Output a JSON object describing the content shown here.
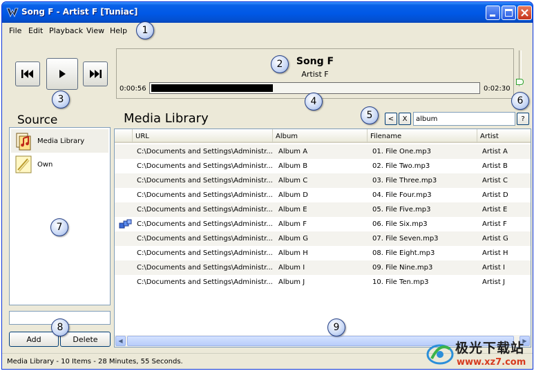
{
  "window": {
    "title": "Song F - Artist F [Tuniac]"
  },
  "menu": [
    "File",
    "Edit",
    "Playback",
    "View",
    "Help"
  ],
  "player": {
    "song_title": "Song F",
    "song_artist": "Artist F",
    "elapsed": "0:00:56",
    "total": "0:02:30",
    "progress": 0.37,
    "volume": 0.15
  },
  "source": {
    "label": "Source",
    "items": [
      {
        "label": "Media Library",
        "icon": "media-library-icon",
        "selected": true
      },
      {
        "label": "Own",
        "icon": "playlist-icon",
        "selected": false
      }
    ],
    "add_label": "Add",
    "delete_label": "Delete"
  },
  "library": {
    "title": "Media Library",
    "back_label": "<",
    "clear_label": "X",
    "search_value": "album",
    "help_label": "?",
    "columns": [
      "URL",
      "Album",
      "Filename",
      "Artist"
    ],
    "rows": [
      [
        "C:\\Documents and Settings\\Administr...",
        "Album A",
        "01. File One.mp3",
        "Artist A"
      ],
      [
        "C:\\Documents and Settings\\Administr...",
        "Album B",
        "02. File Two.mp3",
        "Artist B"
      ],
      [
        "C:\\Documents and Settings\\Administr...",
        "Album C",
        "03. File Three.mp3",
        "Artist C"
      ],
      [
        "C:\\Documents and Settings\\Administr...",
        "Album D",
        "04. File Four.mp3",
        "Artist D"
      ],
      [
        "C:\\Documents and Settings\\Administr...",
        "Album E",
        "05. File Five.mp3",
        "Artist E"
      ],
      [
        "C:\\Documents and Settings\\Administr...",
        "Album F",
        "06. File Six.mp3",
        "Artist F"
      ],
      [
        "C:\\Documents and Settings\\Administr...",
        "Album G",
        "07. File Seven.mp3",
        "Artist G"
      ],
      [
        "C:\\Documents and Settings\\Administr...",
        "Album H",
        "08. File Eight.mp3",
        "Artist H"
      ],
      [
        "C:\\Documents and Settings\\Administr...",
        "Album I",
        "09. File Nine.mp3",
        "Artist I"
      ],
      [
        "C:\\Documents and Settings\\Administr...",
        "Album J",
        "10. File Ten.mp3",
        "Artist J"
      ]
    ],
    "playing_row": 5
  },
  "status": "Media Library - 10 Items - 28 Minutes, 55 Seconds.",
  "callouts": [
    "1",
    "2",
    "3",
    "4",
    "5",
    "6",
    "7",
    "8",
    "9"
  ],
  "watermark": {
    "title": "极光下载站",
    "url": "www.xz7.com"
  },
  "colors": {
    "titlebar": "#0058e6",
    "window_bg": "#ece9d8",
    "watermark_url": "#d63a1e"
  }
}
